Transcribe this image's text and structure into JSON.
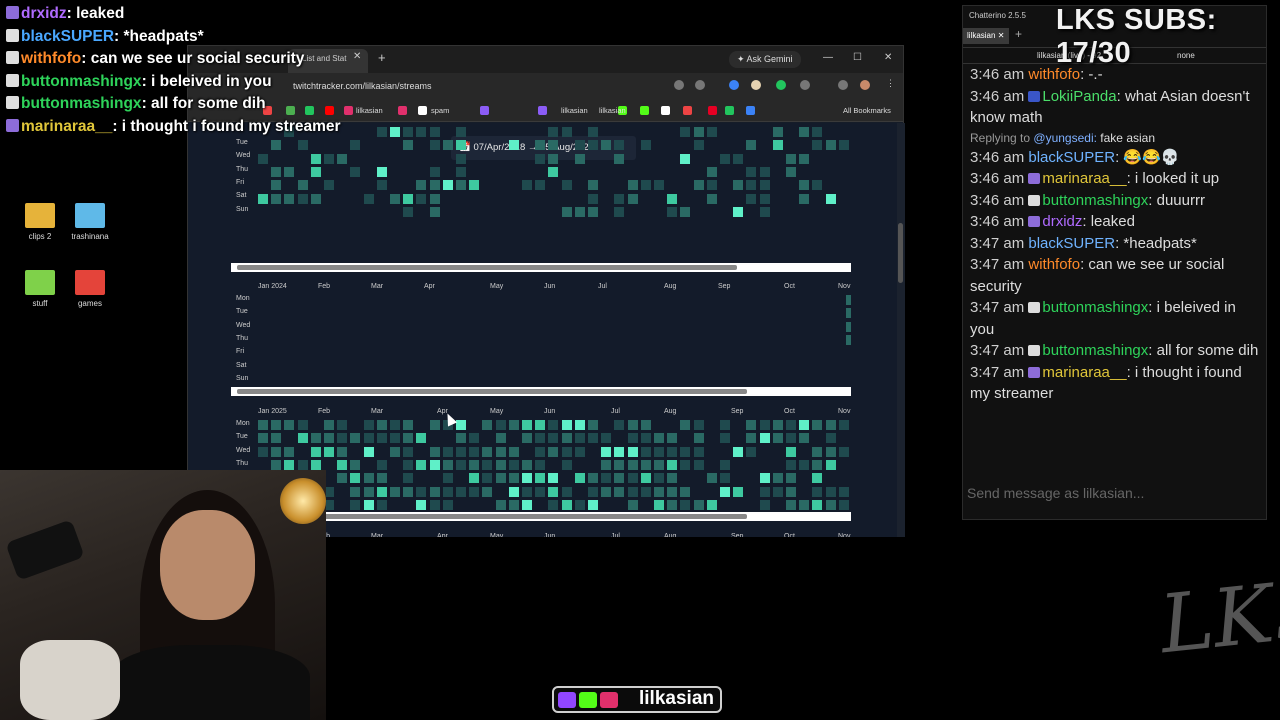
{
  "overlay_chat": [
    {
      "user": "drxidz",
      "text": ": leaked",
      "color": "#b06bff",
      "badge": "p"
    },
    {
      "user": "blackSUPER",
      "text": ": *headpats*",
      "color": "#4aa8ff",
      "badge": ""
    },
    {
      "user": "withfofo",
      "text": ": can we see ur social security",
      "color": "#ff8a2a",
      "badge": ""
    },
    {
      "user": "buttonmashingx",
      "text": ": i beleived in you",
      "color": "#2ed35a",
      "badge": "g"
    },
    {
      "user": "buttonmashingx",
      "text": ": all for some dih",
      "color": "#2ed35a",
      "badge": "g"
    },
    {
      "user": "marinaraa__",
      "text": ": i thought i found my streamer",
      "color": "#e0c63a",
      "badge": "p"
    }
  ],
  "desktop_icons": [
    {
      "label": "clips 2",
      "color": "#e6b33a"
    },
    {
      "label": "trashinana",
      "color": "#5fb9e8"
    },
    {
      "label": "stuff",
      "color": "#7fd14a"
    },
    {
      "label": "games",
      "color": "#e4443a"
    }
  ],
  "browser": {
    "tab_title": "List and Stat",
    "gemini": "Ask Gemini",
    "url": "twitchtracker.com/lilkasian/streams",
    "bookmarks": [
      "lilkasian",
      "spam",
      "lilkasian",
      "lilkasian"
    ],
    "all_bookmarks": "All Bookmarks",
    "date_range": "07/Apr/2018  →  05/Aug/2026",
    "days": [
      "Mon",
      "Tue",
      "Wed",
      "Thu",
      "Fri",
      "Sat",
      "Sun"
    ],
    "days_short": [
      "Tue",
      "Wed",
      "Thu",
      "Fri",
      "Sat",
      "Sun"
    ],
    "months_2024": [
      "Jan 2024",
      "Feb",
      "Mar",
      "Apr",
      "May",
      "Jun",
      "Jul",
      "Aug",
      "Sep",
      "Oct",
      "Nov"
    ],
    "months_2025": [
      "Jan 2025",
      "Feb",
      "Mar",
      "Apr",
      "May",
      "Jun",
      "Jul",
      "Aug",
      "Sep",
      "Oct",
      "Nov"
    ],
    "months_2026": [
      "Feb",
      "Mar",
      "Apr",
      "May",
      "Jun",
      "Jul",
      "Aug",
      "Sep",
      "Oct",
      "Nov"
    ]
  },
  "chatterino": {
    "title": "Chatterino 2.5.5",
    "tab": "lilkasian",
    "channel_header": "lilkasian (live) - 92",
    "mode": "none",
    "messages": [
      {
        "time": "3:46 am",
        "user": "withfofo",
        "text": ": -.-",
        "color": "#ff8a2a",
        "badge": ""
      },
      {
        "time": "3:46 am",
        "user": "LokiiPanda",
        "text": ": what Asian doesn't know math",
        "color": "#4bde6a",
        "badge": "b"
      },
      {
        "reply": "Replying to",
        "reply_user": "@yungsedi:",
        "reply_text": "fake asian"
      },
      {
        "time": "3:46 am",
        "user": "blackSUPER",
        "text": ": 😂😂💀",
        "color": "#6fb3ff",
        "badge": ""
      },
      {
        "time": "3:46 am",
        "user": "marinaraa__",
        "text": ": i looked it up",
        "color": "#e0c63a",
        "badge": "p"
      },
      {
        "time": "3:46 am",
        "user": "buttonmashingx",
        "text": ": duuurrr",
        "color": "#2ed35a",
        "badge": "g"
      },
      {
        "time": "3:46 am",
        "user": "drxidz",
        "text": ": leaked",
        "color": "#b06bff",
        "badge": "v"
      },
      {
        "time": "3:47 am",
        "user": "blackSUPER",
        "text": ": *headpats*",
        "color": "#6fb3ff",
        "badge": ""
      },
      {
        "time": "3:47 am",
        "user": "withfofo",
        "text": ": can we see ur social security",
        "color": "#ff8a2a",
        "badge": ""
      },
      {
        "time": "3:47 am",
        "user": "buttonmashingx",
        "text": ": i beleived in you",
        "color": "#2ed35a",
        "badge": "g"
      },
      {
        "time": "3:47 am",
        "user": "buttonmashingx",
        "text": ": all for some dih",
        "color": "#2ed35a",
        "badge": "g"
      },
      {
        "time": "3:47 am",
        "user": "marinaraa__",
        "text": ": i thought i found my streamer",
        "color": "#e0c63a",
        "badge": "p"
      }
    ],
    "input_placeholder": "Send message as lilkasian..."
  },
  "subs_counter": "LKS SUBS: 17/30",
  "watermark": "LK$",
  "brand_handle": "lilkasian"
}
